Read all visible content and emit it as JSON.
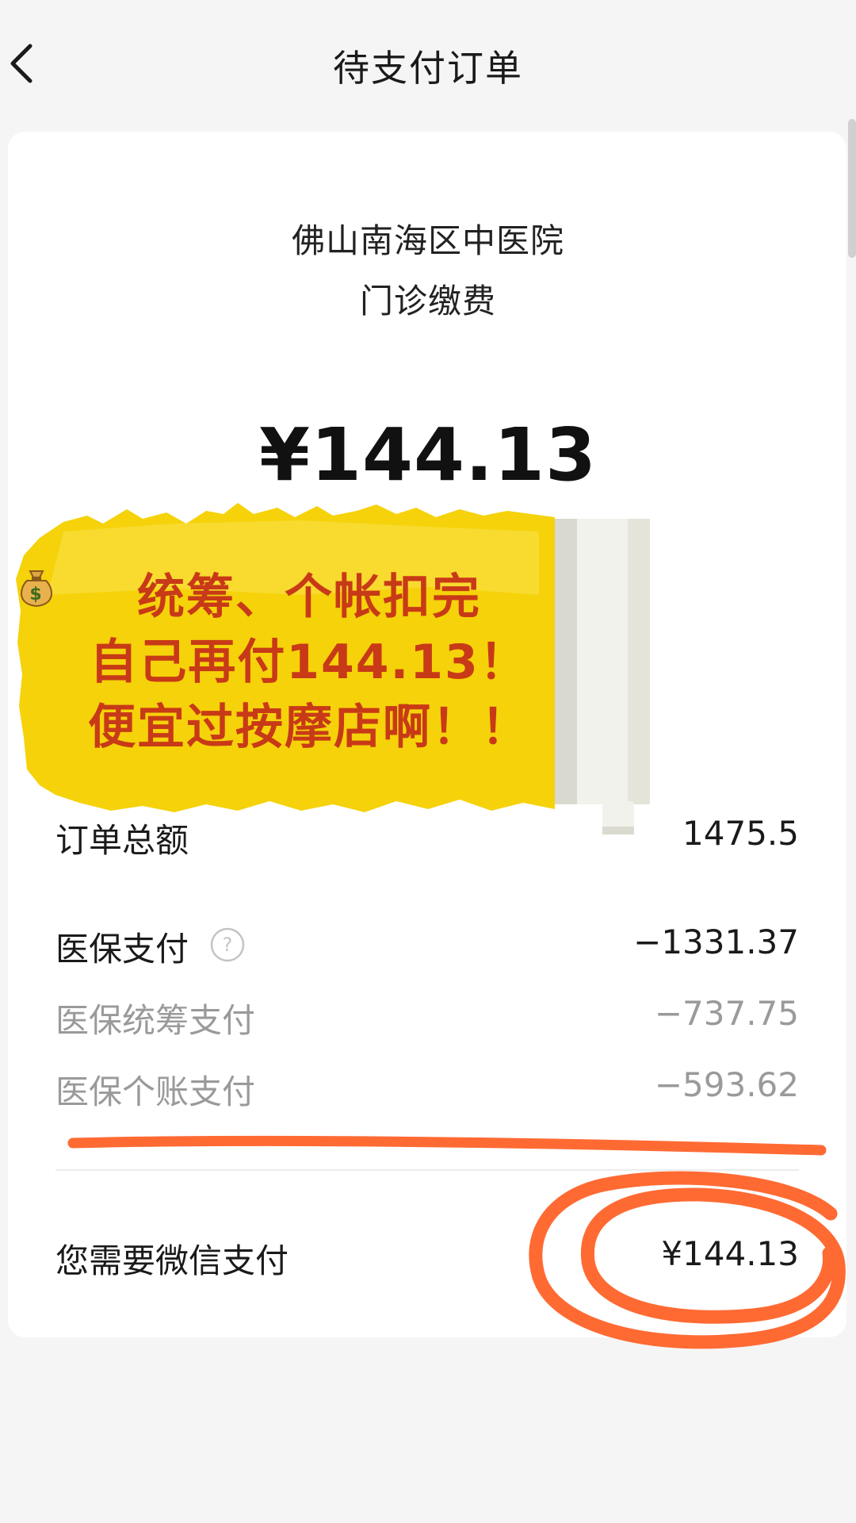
{
  "header": {
    "title": "待支付订单"
  },
  "order": {
    "merchant": "佛山南海区中医院",
    "type": "门诊缴费",
    "amount": "¥144.13"
  },
  "sticker": {
    "line1": "统筹、个帐扣完",
    "line2_prefix": "自己再付",
    "line2_suffix": "144.13！",
    "line3": "便宜过按摩店啊！！"
  },
  "rows": {
    "total": {
      "label": "订单总额",
      "value": "1475.5"
    },
    "insurance": {
      "label": "医保支付",
      "value": "−1331.37"
    },
    "pooled": {
      "label": "医保统筹支付",
      "value": "−737.75"
    },
    "personal": {
      "label": "医保个账支付",
      "value": "−593.62"
    },
    "wechat": {
      "label": "您需要微信支付",
      "value": "¥144.13"
    }
  },
  "icons": {
    "back": "chevron-left-icon",
    "help": "question-circle-icon",
    "moneybag": "money-bag-icon"
  },
  "colors": {
    "background": "#f5f5f5",
    "card": "#ffffff",
    "sticker_yellow": "#f5d20a",
    "sticker_text": "#c83a17",
    "annotation_orange": "#ff6a33",
    "muted_text": "#9a9a9a"
  }
}
